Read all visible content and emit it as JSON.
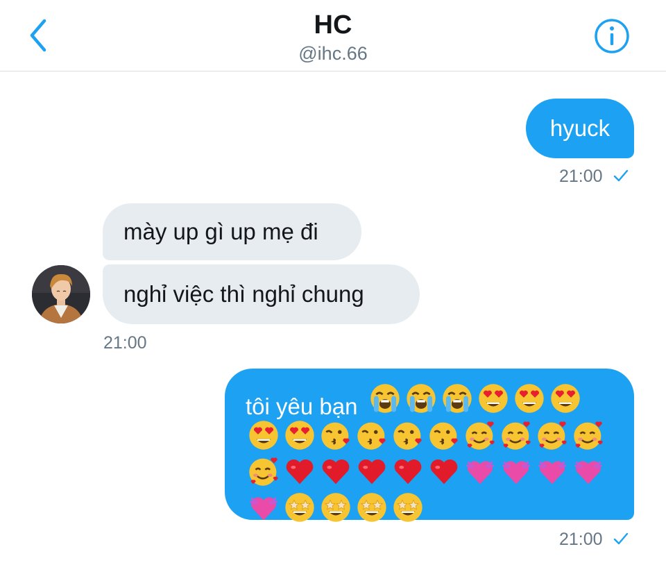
{
  "header": {
    "title": "HC",
    "handle": "@ihc.66",
    "back_icon": "chevron-left-icon",
    "info_icon": "info-icon",
    "accent_color": "#1da1f2"
  },
  "messages": [
    {
      "direction": "outgoing",
      "text": "hyuck",
      "time": "21:00",
      "status_icon": "check-icon"
    },
    {
      "direction": "incoming",
      "text": "mày up gì up mẹ đi"
    },
    {
      "direction": "incoming",
      "text": "nghỉ việc thì nghỉ chung",
      "time": "21:00"
    },
    {
      "direction": "outgoing",
      "text": "tôi yêu bạn",
      "emoji": [
        "loudly-crying-face",
        "loudly-crying-face",
        "loudly-crying-face",
        "heart-eyes-face",
        "heart-eyes-face",
        "heart-eyes-face",
        "heart-eyes-face",
        "heart-eyes-face",
        "kissing-heart-face",
        "kissing-heart-face",
        "kissing-heart-face",
        "kissing-heart-face",
        "smiling-face-with-hearts",
        "smiling-face-with-hearts",
        "smiling-face-with-hearts",
        "smiling-face-with-hearts",
        "smiling-face-with-hearts",
        "red-heart",
        "red-heart",
        "red-heart",
        "red-heart",
        "red-heart",
        "heart-with-arrow-pink",
        "heart-with-arrow-pink",
        "heart-with-arrow-pink",
        "heart-with-arrow-pink",
        "heart-with-arrow-pink",
        "star-struck-face",
        "star-struck-face",
        "star-struck-face",
        "star-struck-face"
      ],
      "time": "21:00",
      "status_icon": "check-icon"
    }
  ]
}
